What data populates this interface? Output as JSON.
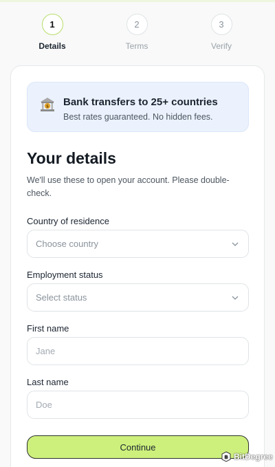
{
  "stepper": {
    "steps": [
      {
        "number": "1",
        "label": "Details",
        "state": "active"
      },
      {
        "number": "2",
        "label": "Terms",
        "state": "upcoming"
      },
      {
        "number": "3",
        "label": "Verify",
        "state": "upcoming"
      }
    ]
  },
  "promo": {
    "icon": "bank-icon",
    "title": "Bank transfers to 25+ countries",
    "subtitle": "Best rates guaranteed. No hidden fees."
  },
  "form": {
    "heading": "Your details",
    "intro": "We'll use these to open your account. Please double-check.",
    "country": {
      "label": "Country of residence",
      "value": "Choose country"
    },
    "employment": {
      "label": "Employment status",
      "value": "Select status"
    },
    "first_name": {
      "label": "First name",
      "placeholder": "Jane",
      "value": ""
    },
    "last_name": {
      "label": "Last name",
      "placeholder": "Doe",
      "value": ""
    },
    "continue_label": "Continue"
  },
  "watermark": {
    "text": "BitDegree"
  },
  "colors": {
    "accent_green": "#cdf07c",
    "active_step_ring": "#b8dd6a",
    "promo_bg": "#ebf2fd"
  }
}
